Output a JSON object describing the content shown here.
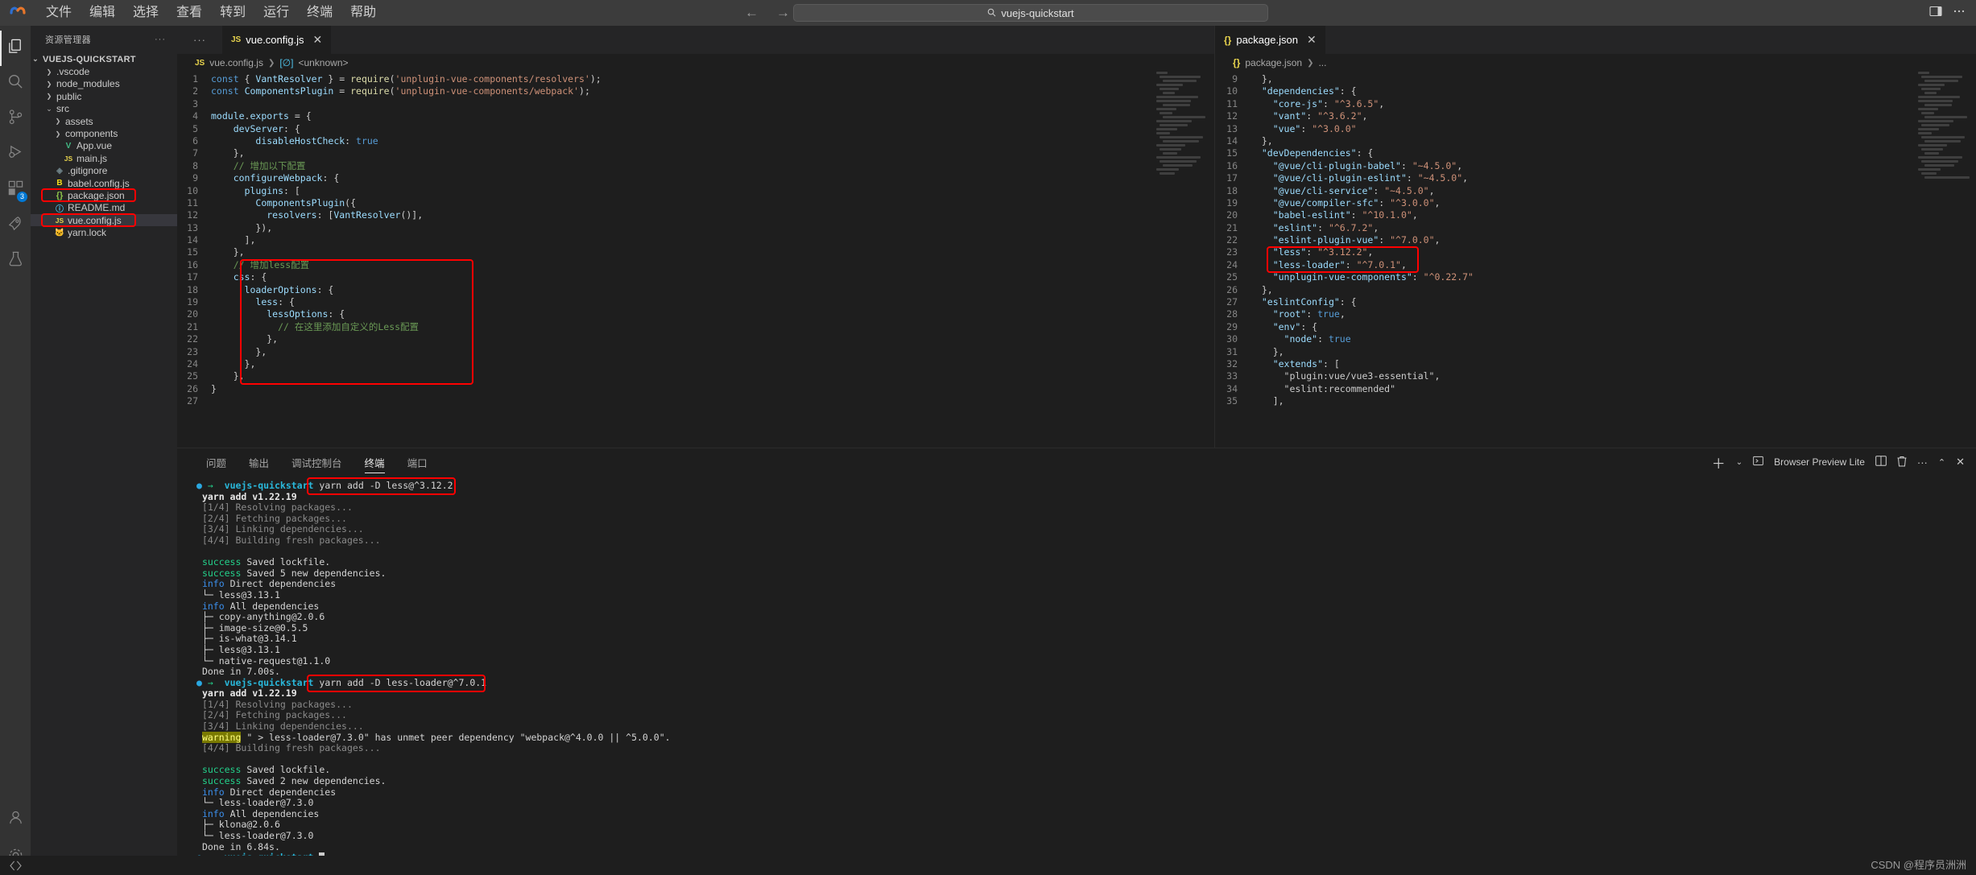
{
  "titlebar": {
    "menu": [
      "文件",
      "编辑",
      "选择",
      "查看",
      "转到",
      "运行",
      "终端",
      "帮助"
    ],
    "back_icon": "arrow-left-icon",
    "forward_icon": "arrow-right-icon",
    "quick_open_value": "vuejs-quickstart",
    "search_icon": "search-icon"
  },
  "activitybar": {
    "items": [
      {
        "name": "explorer",
        "icon": "files-icon",
        "active": true,
        "badge": ""
      },
      {
        "name": "search",
        "icon": "search-icon",
        "active": false,
        "badge": ""
      },
      {
        "name": "source-control",
        "icon": "source-control-icon",
        "active": false,
        "badge": ""
      },
      {
        "name": "run-and-debug",
        "icon": "run-debug-icon",
        "active": false,
        "badge": ""
      },
      {
        "name": "extensions",
        "icon": "extensions-icon",
        "active": false,
        "badge": "3"
      },
      {
        "name": "remote-explorer",
        "icon": "remote-icon",
        "active": false,
        "badge": ""
      },
      {
        "name": "test",
        "icon": "beaker-icon",
        "active": false,
        "badge": ""
      }
    ],
    "bottom": [
      {
        "name": "accounts",
        "icon": "account-icon"
      },
      {
        "name": "settings",
        "icon": "gear-icon"
      }
    ]
  },
  "sidebar": {
    "title": "资源管理器",
    "more_icon": "ellipsis-icon",
    "root": "VUEJS-QUICKSTART",
    "tree": [
      {
        "label": ".vscode",
        "depth": 1,
        "chev": "›",
        "icon": "",
        "icon_color": "",
        "selected": false,
        "highlight": false
      },
      {
        "label": "node_modules",
        "depth": 1,
        "chev": "›",
        "icon": "",
        "icon_color": "",
        "selected": false,
        "highlight": false
      },
      {
        "label": "public",
        "depth": 1,
        "chev": "›",
        "icon": "",
        "icon_color": "",
        "selected": false,
        "highlight": false
      },
      {
        "label": "src",
        "depth": 1,
        "chev": "⌄",
        "icon": "",
        "icon_color": "",
        "selected": false,
        "highlight": false
      },
      {
        "label": "assets",
        "depth": 2,
        "chev": "›",
        "icon": "",
        "icon_color": "",
        "selected": false,
        "highlight": false
      },
      {
        "label": "components",
        "depth": 2,
        "chev": "›",
        "icon": "",
        "icon_color": "",
        "selected": false,
        "highlight": false
      },
      {
        "label": "App.vue",
        "depth": 2,
        "chev": "",
        "icon": "V",
        "icon_color": "#41b883",
        "selected": false,
        "highlight": false
      },
      {
        "label": "main.js",
        "depth": 2,
        "chev": "",
        "icon": "JS",
        "icon_color": "#e8d44d",
        "selected": false,
        "highlight": false
      },
      {
        "label": ".gitignore",
        "depth": 1,
        "chev": "",
        "icon": "◈",
        "icon_color": "#6d8086",
        "selected": false,
        "highlight": false
      },
      {
        "label": "babel.config.js",
        "depth": 1,
        "chev": "",
        "icon": "B",
        "icon_color": "#f5de19",
        "selected": false,
        "highlight": false
      },
      {
        "label": "package.json",
        "depth": 1,
        "chev": "",
        "icon": "{}",
        "icon_color": "#8bc34a",
        "selected": false,
        "highlight": true
      },
      {
        "label": "README.md",
        "depth": 1,
        "chev": "",
        "icon": "ⓘ",
        "icon_color": "#4fc1e9",
        "selected": false,
        "highlight": false
      },
      {
        "label": "vue.config.js",
        "depth": 1,
        "chev": "",
        "icon": "JS",
        "icon_color": "#e8d44d",
        "selected": true,
        "highlight": true
      },
      {
        "label": "yarn.lock",
        "depth": 1,
        "chev": "",
        "icon": "🐱",
        "icon_color": "#4fa6e0",
        "selected": false,
        "highlight": false
      }
    ]
  },
  "editor_left": {
    "tab": {
      "label": "vue.config.js",
      "icon": "js-file-icon",
      "close_icon": "close-icon"
    },
    "breadcrumb": [
      "vue.config.js",
      "<unknown>"
    ],
    "breadcrumb_icon": "js-file-icon",
    "symbol_icon": "[∅]",
    "first_line": 1,
    "lines": [
      "const { VantResolver } = require('unplugin-vue-components/resolvers');",
      "const ComponentsPlugin = require('unplugin-vue-components/webpack');",
      "",
      "module.exports = {",
      "    devServer: {",
      "        disableHostCheck: true",
      "    },",
      "    // 增加以下配置",
      "    configureWebpack: {",
      "      plugins: [",
      "        ComponentsPlugin({",
      "          resolvers: [VantResolver()],",
      "        }),",
      "      ],",
      "    },",
      "    // 增加less配置",
      "    css: {",
      "      loaderOptions: {",
      "        less: {",
      "          lessOptions: {",
      "            // 在这里添加自定义的Less配置",
      "          },",
      "        },",
      "      },",
      "    },",
      "}",
      ""
    ]
  },
  "editor_right": {
    "tab": {
      "label": "package.json",
      "icon": "json-file-icon",
      "close_icon": "close-icon"
    },
    "breadcrumb": [
      "package.json",
      "..."
    ],
    "first_line": 9,
    "lines": [
      "  },",
      "  \"dependencies\": {",
      "    \"core-js\": \"^3.6.5\",",
      "    \"vant\": \"^3.6.2\",",
      "    \"vue\": \"^3.0.0\"",
      "  },",
      "  \"devDependencies\": {",
      "    \"@vue/cli-plugin-babel\": \"~4.5.0\",",
      "    \"@vue/cli-plugin-eslint\": \"~4.5.0\",",
      "    \"@vue/cli-service\": \"~4.5.0\",",
      "    \"@vue/compiler-sfc\": \"^3.0.0\",",
      "    \"babel-eslint\": \"^10.1.0\",",
      "    \"eslint\": \"^6.7.2\",",
      "    \"eslint-plugin-vue\": \"^7.0.0\",",
      "    \"less\": \"^3.12.2\",",
      "    \"less-loader\": \"^7.0.1\",",
      "    \"unplugin-vue-components\": \"^0.22.7\"",
      "  },",
      "  \"eslintConfig\": {",
      "    \"root\": true,",
      "    \"env\": {",
      "      \"node\": true",
      "    },",
      "    \"extends\": [",
      "      \"plugin:vue/vue3-essential\",",
      "      \"eslint:recommended\"",
      "    ],"
    ]
  },
  "panel": {
    "tabs": [
      "问题",
      "输出",
      "调试控制台",
      "终端",
      "端口"
    ],
    "active_tab": "终端",
    "actions": {
      "add_icon": "plus-icon",
      "chevron_icon": "chevron-down-icon",
      "terminal_name": "Browser Preview Lite",
      "terminal_icon": "terminal-icon",
      "split_icon": "split-editor-icon",
      "trash_icon": "trash-icon",
      "more_icon": "ellipsis-icon",
      "chevron_up_icon": "chevron-up-icon",
      "close_icon": "close-icon"
    },
    "terminal": {
      "prompt_dir": "vuejs-quickstart",
      "command_1": "yarn add -D less@^3.12.2",
      "command_2": "yarn add -D less-loader@^7.0.1",
      "block_1": [
        {
          "t": "bold",
          "s": "yarn add v1.22.19"
        },
        {
          "t": "dim",
          "s": "[1/4] Resolving packages..."
        },
        {
          "t": "dim",
          "s": "[2/4] Fetching packages..."
        },
        {
          "t": "dim",
          "s": "[3/4] Linking dependencies..."
        },
        {
          "t": "dim",
          "s": "[4/4] Building fresh packages..."
        },
        {
          "t": "blank",
          "s": ""
        },
        {
          "t": "success",
          "s": "Saved lockfile."
        },
        {
          "t": "success",
          "s": "Saved 5 new dependencies."
        },
        {
          "t": "info",
          "s": "Direct dependencies"
        },
        {
          "t": "white",
          "s": "└─ less@3.13.1"
        },
        {
          "t": "info",
          "s": "All dependencies"
        },
        {
          "t": "white",
          "s": "├─ copy-anything@2.0.6"
        },
        {
          "t": "white",
          "s": "├─ image-size@0.5.5"
        },
        {
          "t": "white",
          "s": "├─ is-what@3.14.1"
        },
        {
          "t": "white",
          "s": "├─ less@3.13.1"
        },
        {
          "t": "white",
          "s": "└─ native-request@1.1.0"
        },
        {
          "t": "white",
          "s": "Done in 7.00s."
        }
      ],
      "block_2": [
        {
          "t": "bold",
          "s": "yarn add v1.22.19"
        },
        {
          "t": "dim",
          "s": "[1/4] Resolving packages..."
        },
        {
          "t": "dim",
          "s": "[2/4] Fetching packages..."
        },
        {
          "t": "dim",
          "s": "[3/4] Linking dependencies..."
        },
        {
          "t": "warning",
          "s": "\" > less-loader@7.3.0\" has unmet peer dependency \"webpack@^4.0.0 || ^5.0.0\"."
        },
        {
          "t": "dim",
          "s": "[4/4] Building fresh packages..."
        },
        {
          "t": "blank",
          "s": ""
        },
        {
          "t": "success",
          "s": "Saved lockfile."
        },
        {
          "t": "success",
          "s": "Saved 2 new dependencies."
        },
        {
          "t": "info",
          "s": "Direct dependencies"
        },
        {
          "t": "white",
          "s": "└─ less-loader@7.3.0"
        },
        {
          "t": "info",
          "s": "All dependencies"
        },
        {
          "t": "white",
          "s": "├─ klona@2.0.6"
        },
        {
          "t": "white",
          "s": "└─ less-loader@7.3.0"
        },
        {
          "t": "white",
          "s": "Done in 6.84s."
        }
      ],
      "labels": {
        "success": "success",
        "info": "info",
        "warning": "warning"
      }
    }
  },
  "watermark": "CSDN @程序员洲洲",
  "colors": {
    "highlight": "#ff0000",
    "accent": "#0078d4",
    "editor_bg": "#1e1e1e",
    "sidebar_bg": "#252526",
    "titlebar_bg": "#3c3c3c"
  }
}
